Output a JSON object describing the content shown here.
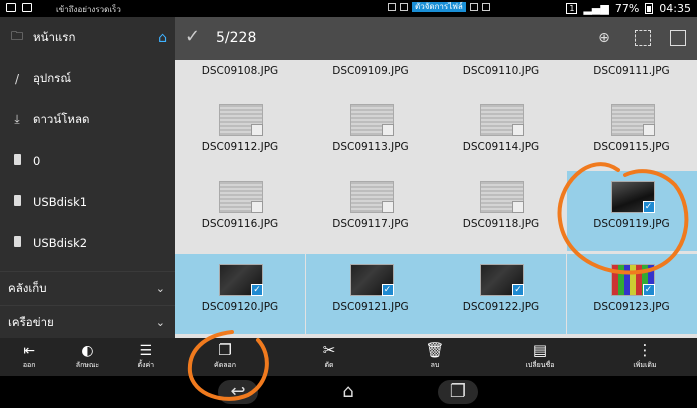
{
  "status": {
    "notice": "เข้าถึงอย่างรวดเร็ว",
    "app_pill": "ตัวจัดการไฟล์",
    "sim": "1",
    "battery": "77%",
    "time": "04:35"
  },
  "sidebar": {
    "items": [
      {
        "label": "หน้าแรก",
        "icon": "folder-icon"
      },
      {
        "label": "อุปกรณ์",
        "icon": "slash-icon"
      },
      {
        "label": "ดาวน์โหลด",
        "icon": "download-icon"
      },
      {
        "label": "0",
        "icon": "drive-icon"
      },
      {
        "label": "USBdisk1",
        "icon": "drive-icon"
      },
      {
        "label": "USBdisk2",
        "icon": "drive-icon"
      }
    ],
    "sections": [
      {
        "label": "คลังเก็บ"
      },
      {
        "label": "เครือข่าย"
      }
    ],
    "bottom": [
      {
        "label": "ออก",
        "icon": "exit-icon"
      },
      {
        "label": "ลักษณะ",
        "icon": "theme-icon"
      },
      {
        "label": "ตั้งค่า",
        "icon": "settings-icon"
      }
    ]
  },
  "toolbar": {
    "count": "5/228"
  },
  "files": [
    {
      "name": "DSC09108.JPG",
      "selected": false,
      "thumb": "doc"
    },
    {
      "name": "DSC09109.JPG",
      "selected": false,
      "thumb": "doc"
    },
    {
      "name": "DSC09110.JPG",
      "selected": false,
      "thumb": "doc"
    },
    {
      "name": "DSC09111.JPG",
      "selected": false,
      "thumb": "doc"
    },
    {
      "name": "DSC09112.JPG",
      "selected": false,
      "thumb": "doc"
    },
    {
      "name": "DSC09113.JPG",
      "selected": false,
      "thumb": "doc"
    },
    {
      "name": "DSC09114.JPG",
      "selected": false,
      "thumb": "doc"
    },
    {
      "name": "DSC09115.JPG",
      "selected": false,
      "thumb": "doc"
    },
    {
      "name": "DSC09116.JPG",
      "selected": false,
      "thumb": "doc"
    },
    {
      "name": "DSC09117.JPG",
      "selected": false,
      "thumb": "doc"
    },
    {
      "name": "DSC09118.JPG",
      "selected": false,
      "thumb": "doc"
    },
    {
      "name": "DSC09119.JPG",
      "selected": true,
      "thumb": "dark"
    },
    {
      "name": "DSC09120.JPG",
      "selected": true,
      "thumb": "phone"
    },
    {
      "name": "DSC09121.JPG",
      "selected": true,
      "thumb": "phone"
    },
    {
      "name": "DSC09122.JPG",
      "selected": true,
      "thumb": "phone"
    },
    {
      "name": "DSC09123.JPG",
      "selected": true,
      "thumb": "colorful"
    }
  ],
  "actions": [
    {
      "label": "คัดลอก",
      "icon": "copy-icon"
    },
    {
      "label": "ตัด",
      "icon": "scissors-icon"
    },
    {
      "label": "ลบ",
      "icon": "trash-icon"
    },
    {
      "label": "เปลี่ยนชื่อ",
      "icon": "rename-icon"
    },
    {
      "label": "เพิ่มเติม",
      "icon": "more-icon"
    }
  ],
  "colors": {
    "selection": "#96cfe8",
    "accent": "#1f8ad1",
    "annotation": "#f07a1e"
  }
}
